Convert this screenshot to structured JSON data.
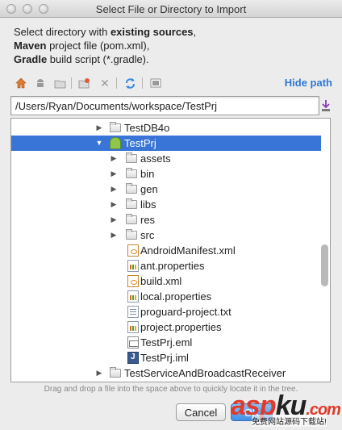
{
  "window": {
    "title": "Select File or Directory to Import"
  },
  "description": {
    "line1": "Select directory with ",
    "line1_bold": "existing sources",
    "line1_end": ",",
    "line2_bold": "Maven",
    "line2": " project file (pom.xml),",
    "line3_bold": "Gradle",
    "line3": " build script (*.gradle)."
  },
  "toolbar": {
    "icons": [
      "home-icon",
      "android-icon",
      "folder-icon",
      "new-folder-icon",
      "delete-icon",
      "refresh-icon",
      "show-hidden-icon"
    ],
    "hide_path_label": "Hide path"
  },
  "path": {
    "value": "/Users/Ryan/Documents/workspace/TestPrj"
  },
  "tree": {
    "items": [
      {
        "label": "TestDB4o",
        "type": "folder",
        "expanded": false,
        "selected": false
      },
      {
        "label": "TestPrj",
        "type": "android-module",
        "expanded": true,
        "selected": true
      },
      {
        "label": "assets",
        "type": "folder",
        "expanded": false,
        "selected": false
      },
      {
        "label": "bin",
        "type": "folder",
        "expanded": false,
        "selected": false
      },
      {
        "label": "gen",
        "type": "folder",
        "expanded": false,
        "selected": false
      },
      {
        "label": "libs",
        "type": "folder",
        "expanded": false,
        "selected": false
      },
      {
        "label": "res",
        "type": "folder",
        "expanded": false,
        "selected": false
      },
      {
        "label": "src",
        "type": "folder",
        "expanded": false,
        "selected": false
      },
      {
        "label": "AndroidManifest.xml",
        "type": "xml-file",
        "selected": false
      },
      {
        "label": "ant.properties",
        "type": "properties-file",
        "selected": false
      },
      {
        "label": "build.xml",
        "type": "xml-file",
        "selected": false
      },
      {
        "label": "local.properties",
        "type": "properties-file",
        "selected": false
      },
      {
        "label": "proguard-project.txt",
        "type": "text-file",
        "selected": false
      },
      {
        "label": "project.properties",
        "type": "properties-file",
        "selected": false
      },
      {
        "label": "TestPrj.eml",
        "type": "eml-file",
        "selected": false
      },
      {
        "label": "TestPrj.iml",
        "type": "iml-file",
        "selected": false
      },
      {
        "label": "TestServiceAndBroadcastReceiver",
        "type": "folder",
        "expanded": false,
        "selected": false
      }
    ]
  },
  "hint": "Drag and drop a file into the space above to quickly locate it in the tree.",
  "buttons": {
    "cancel_label": "Cancel",
    "ok_label": "OK"
  },
  "watermark": {
    "brand_a": "asp",
    "brand_b": "ku",
    "brand_c": ".com",
    "subtitle": "免费网站源码下载站!"
  },
  "colors": {
    "selection": "#3875d7",
    "link": "#2f77d4"
  }
}
